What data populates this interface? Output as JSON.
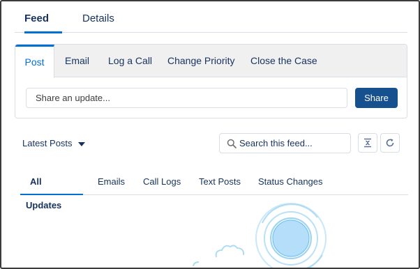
{
  "top_tabs": {
    "feed": "Feed",
    "details": "Details"
  },
  "publisher": {
    "tabs": {
      "post": "Post",
      "email": "Email",
      "log_call": "Log a Call",
      "change_priority": "Change Priority",
      "close_case": "Close the Case"
    },
    "input_placeholder": "Share an update...",
    "share_label": "Share"
  },
  "feed": {
    "sort_label": "Latest Posts",
    "search_placeholder": "Search this feed...",
    "filter_tabs": {
      "all": "All Updates",
      "emails": "Emails",
      "call_logs": "Call Logs",
      "text_posts": "Text Posts",
      "status_changes": "Status Changes"
    }
  },
  "colors": {
    "accent": "#0070d2",
    "share_button": "#16508e",
    "text": "#16325c",
    "border": "#d8dde6"
  },
  "icons": [
    "search-icon",
    "caret-down-icon",
    "collapse-icon",
    "refresh-icon",
    "empty-feed-illustration"
  ]
}
